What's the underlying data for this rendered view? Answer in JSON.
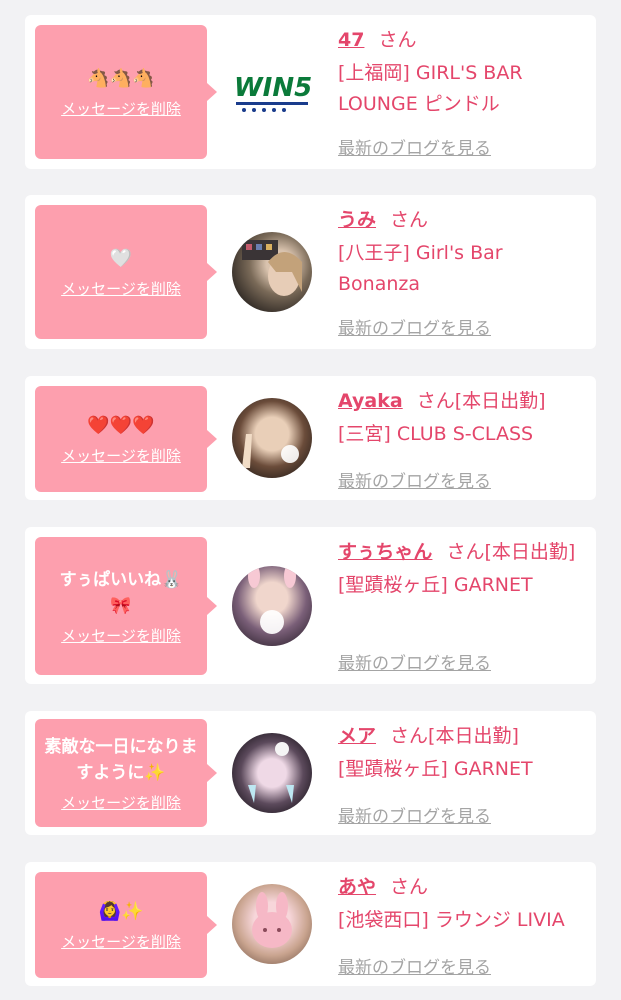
{
  "cards": [
    {
      "message": "🐴🐴🐴",
      "delete_label": "メッセージを削除",
      "avatar_icon": "win5-logo",
      "logo_text": "WIN5",
      "name": "47",
      "san": "さん",
      "status": "",
      "shop": "[上福岡] GIRL'S BAR LOUNGE ピンドル",
      "blog_label": "最新のブログを見る"
    },
    {
      "message": "🤍",
      "delete_label": "メッセージを削除",
      "avatar_icon": "girl-photo-avatar",
      "name": "うみ",
      "san": "さん",
      "status": "",
      "shop": "[八王子] Girl's Bar Bonanza",
      "blog_label": "最新のブログを見る"
    },
    {
      "message": "❤️❤️❤️",
      "delete_label": "メッセージを削除",
      "avatar_icon": "girl-photo-avatar",
      "name": "Ayaka",
      "san": "さん",
      "status": "[本日出勤]",
      "shop": "[三宮] CLUB S-CLASS",
      "blog_label": "最新のブログを見る"
    },
    {
      "message": "すぅぱいいね🐰\n🎀",
      "delete_label": "メッセージを削除",
      "avatar_icon": "girl-photo-avatar",
      "name": "すぅちゃん",
      "san": "さん",
      "status": "[本日出勤]",
      "shop": "[聖蹟桜ヶ丘] GARNET",
      "blog_label": "最新のブログを見る"
    },
    {
      "message": "素敵な一日になりますように✨",
      "delete_label": "メッセージを削除",
      "avatar_icon": "girl-photo-avatar",
      "name": "メア",
      "san": "さん",
      "status": "[本日出勤]",
      "shop": "[聖蹟桜ヶ丘] GARNET",
      "blog_label": "最新のブログを見る"
    },
    {
      "message": "🙆‍♀️✨",
      "delete_label": "メッセージを削除",
      "avatar_icon": "girl-photo-avatar",
      "name": "あや",
      "san": "さん",
      "status": "",
      "shop": "[池袋西口] ラウンジ LIVIA",
      "blog_label": "最新のブログを見る"
    }
  ],
  "colors": {
    "bubble": "#fd9fae",
    "accent": "#e4466b",
    "muted": "#a4a4a4",
    "background": "#f2f2f4"
  }
}
